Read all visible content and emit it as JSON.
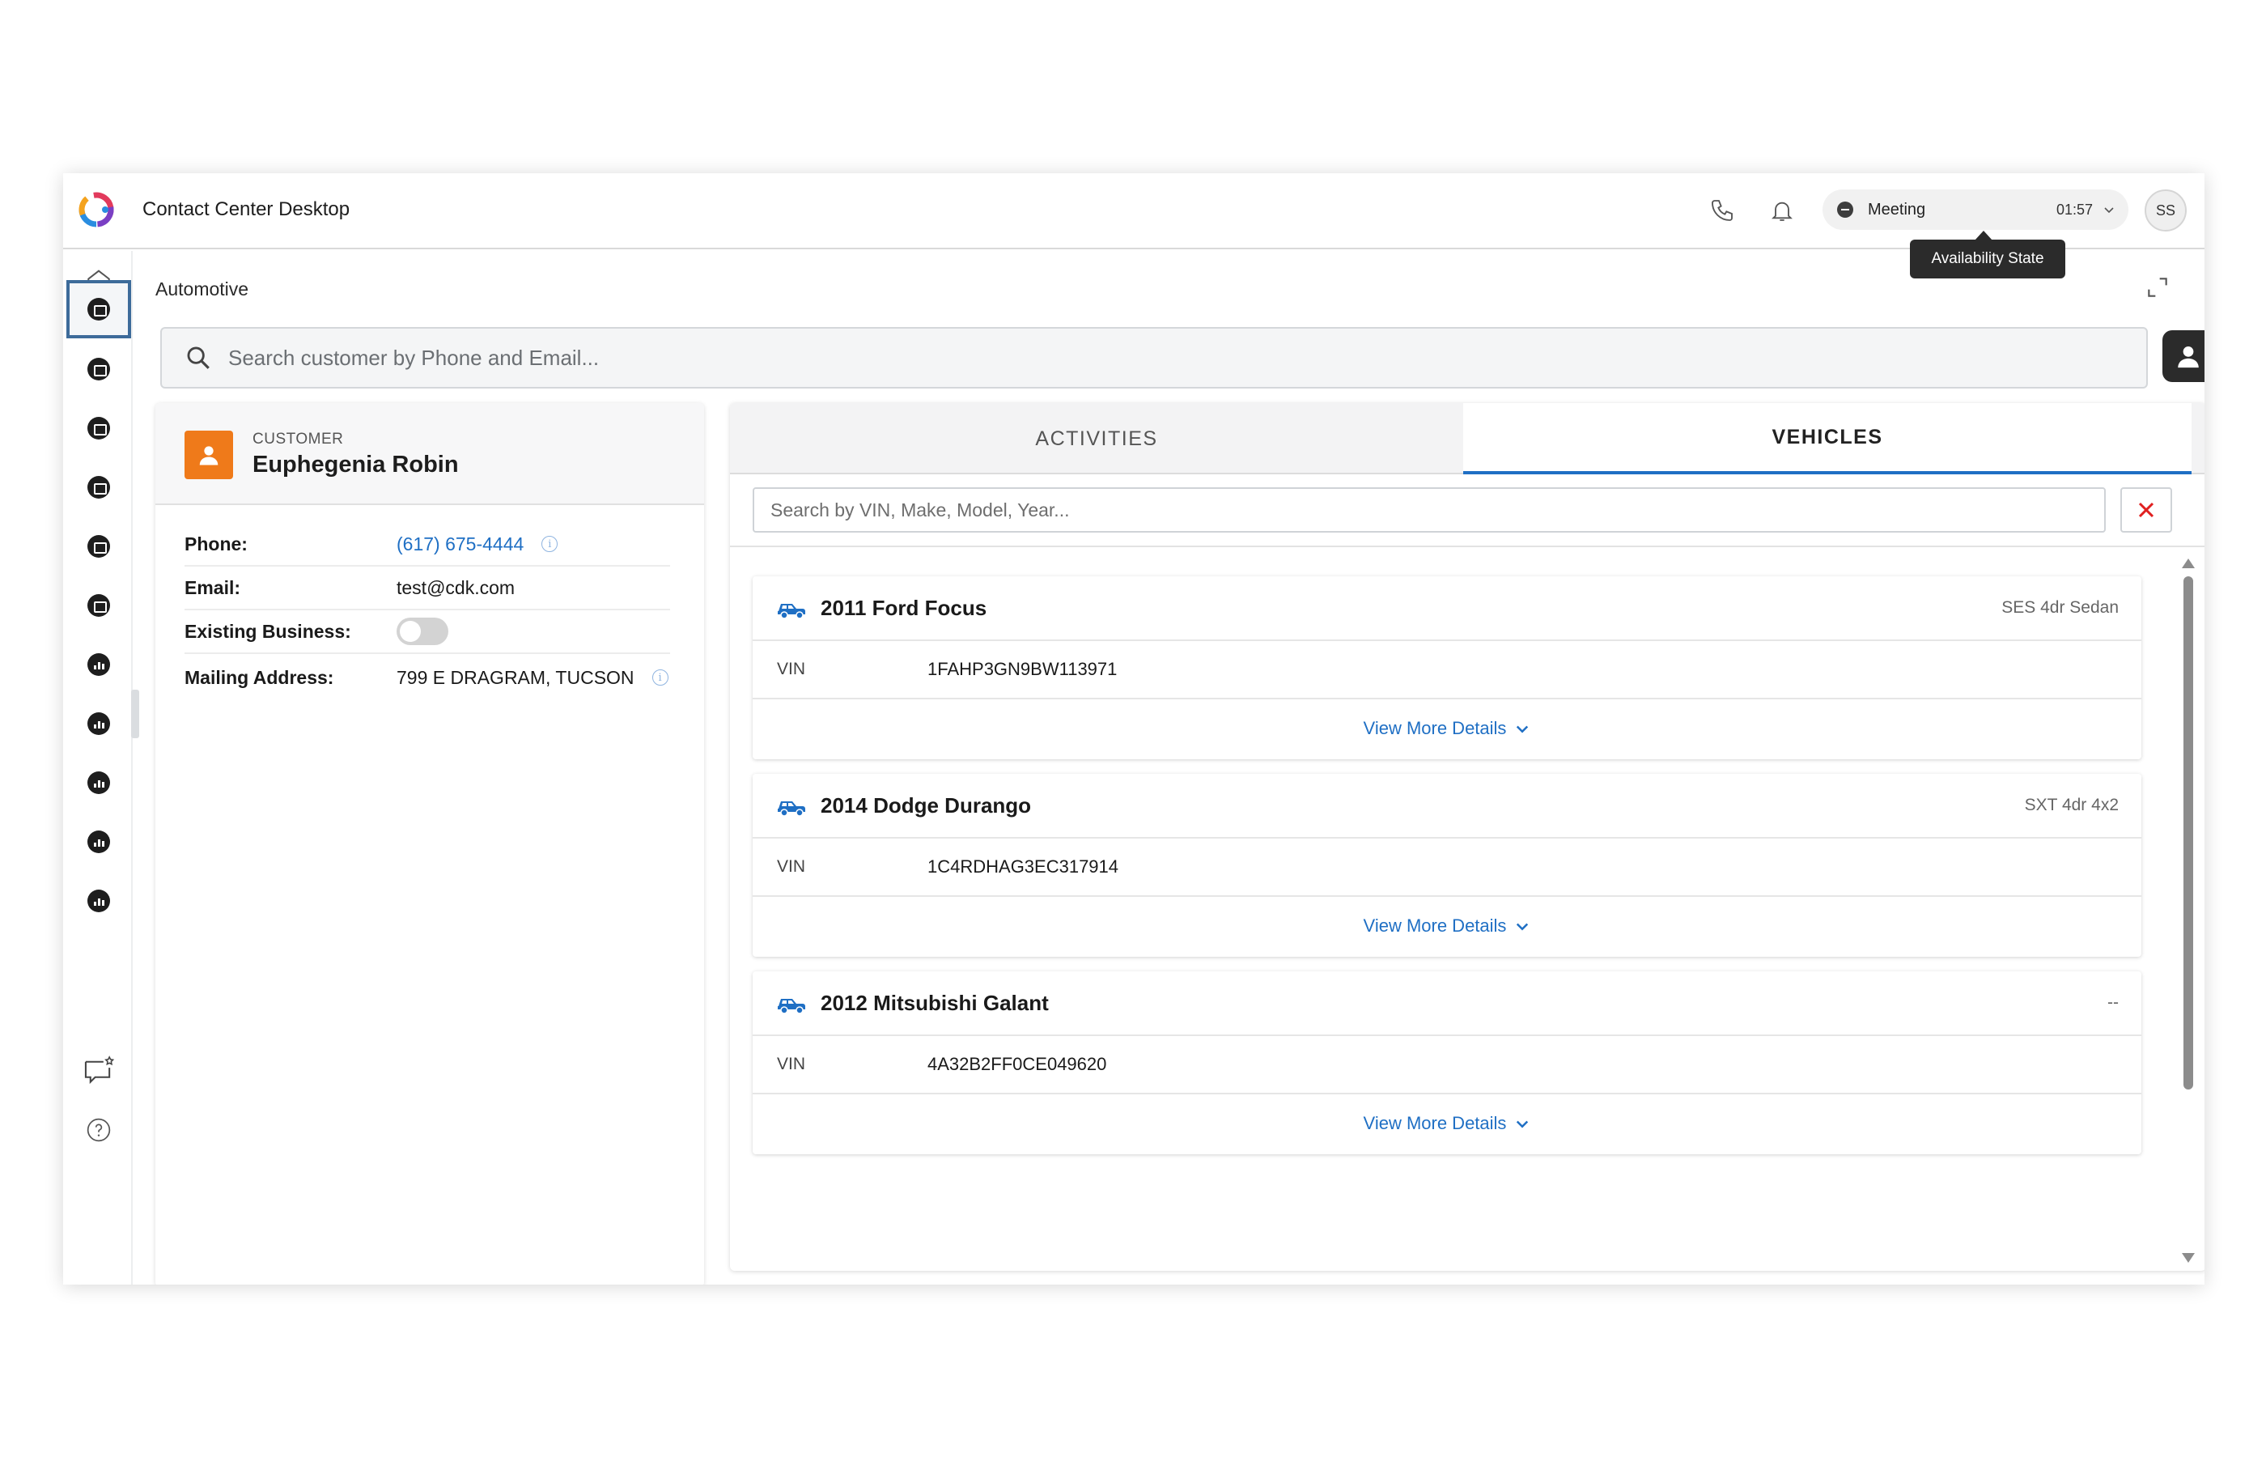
{
  "app": {
    "title": "Contact Center Desktop"
  },
  "header": {
    "status_label": "Meeting",
    "status_timer": "01:57",
    "avatar_initials": "SS",
    "tooltip": "Availability State"
  },
  "breadcrumb": "Automotive",
  "search": {
    "placeholder": "Search customer by Phone and Email..."
  },
  "customer": {
    "tag": "CUSTOMER",
    "name": "Euphegenia Robin",
    "fields": {
      "phone_label": "Phone:",
      "phone_value": "(617) 675-4444",
      "email_label": "Email:",
      "email_value": "test@cdk.com",
      "existing_label": "Existing Business:",
      "existing_value": false,
      "address_label": "Mailing Address:",
      "address_value": "799 E DRAGRAM, TUCSON"
    }
  },
  "tabs": [
    {
      "label": "ACTIVITIES",
      "active": false
    },
    {
      "label": "VEHICLES",
      "active": true
    }
  ],
  "vehicle_search": {
    "placeholder": "Search by VIN, Make, Model, Year..."
  },
  "vehicles": [
    {
      "title": "2011 Ford Focus",
      "trim": "SES 4dr Sedan",
      "vin_label": "VIN",
      "vin": "1FAHP3GN9BW113971",
      "more": "View More Details"
    },
    {
      "title": "2014 Dodge Durango",
      "trim": "SXT 4dr 4x2",
      "vin_label": "VIN",
      "vin": "1C4RDHAG3EC317914",
      "more": "View More Details"
    },
    {
      "title": "2012 Mitsubishi Galant",
      "trim": "--",
      "vin_label": "VIN",
      "vin": "4A32B2FF0CE049620",
      "more": "View More Details"
    }
  ],
  "colors": {
    "accent": "#1f6fc4",
    "customer_avatar": "#ef7a1a",
    "clear_icon": "#e02020",
    "rail_active": "#3d6b9a"
  },
  "icons": {
    "header": [
      "phone-icon",
      "bell-icon"
    ],
    "rail": [
      "home-icon",
      "app-icon",
      "chart-icon",
      "chat-star-icon",
      "help-icon"
    ]
  }
}
